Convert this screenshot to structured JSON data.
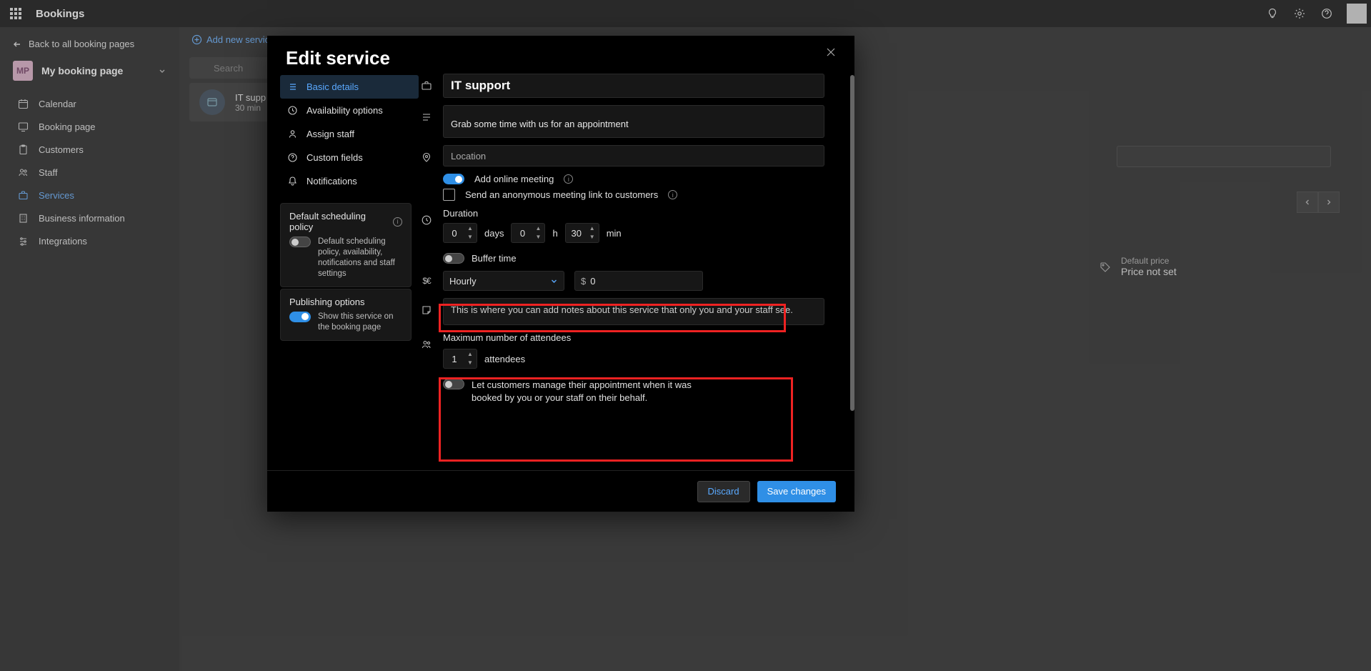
{
  "app": {
    "title": "Bookings"
  },
  "back_link": "Back to all booking pages",
  "mp": {
    "badge": "MP",
    "label": "My booking page"
  },
  "nav": {
    "calendar": "Calendar",
    "booking_page": "Booking page",
    "customers": "Customers",
    "staff": "Staff",
    "services": "Services",
    "business_info": "Business information",
    "integrations": "Integrations"
  },
  "main": {
    "add_new": "Add new service",
    "search_placeholder": "Search",
    "svc_name": "IT supp",
    "svc_dur": "30 min",
    "default_price_label": "Default price",
    "default_price_value": "Price not set"
  },
  "modal": {
    "title": "Edit service",
    "tabs": {
      "basic": "Basic details",
      "availability": "Availability options",
      "assign": "Assign staff",
      "custom": "Custom fields",
      "notifications": "Notifications"
    },
    "sched_policy_title": "Default scheduling policy",
    "sched_policy_desc": "Default scheduling policy, availability, notifications and staff settings",
    "pub_title": "Publishing options",
    "pub_desc": "Show this service on the booking page",
    "form": {
      "name_value": "IT support",
      "desc_value": "Grab some time with us for an appointment",
      "location_placeholder": "Location",
      "online_meeting_label": "Add online meeting",
      "anon_label": "Send an anonymous meeting link to customers",
      "duration_label": "Duration",
      "days": "0",
      "days_unit": "days",
      "hours": "0",
      "hours_unit": "h",
      "mins": "30",
      "mins_unit": "min",
      "buffer_label": "Buffer time",
      "price_type": "Hourly",
      "price_currency": "$",
      "price_value": "0",
      "notes_placeholder": "This is where you can add notes about this service that only you and your staff see.",
      "max_label": "Maximum number of attendees",
      "max_value": "1",
      "max_unit": "attendees",
      "let_customers_label": "Let customers manage their appointment when it was booked by you or your staff on their behalf."
    },
    "footer": {
      "discard": "Discard",
      "save": "Save changes"
    }
  }
}
